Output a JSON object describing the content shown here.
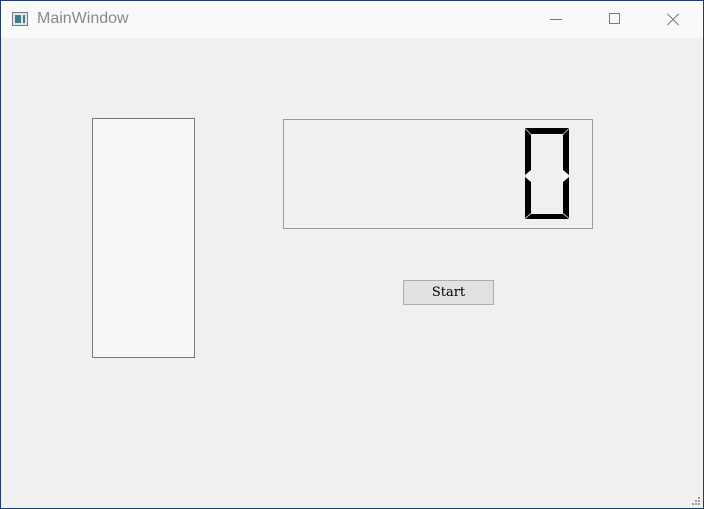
{
  "window": {
    "title": "MainWindow",
    "icon": "app-window-icon",
    "controls": [
      "minimize-icon",
      "maximize-icon",
      "close-icon"
    ]
  },
  "lcd": {
    "value": "0",
    "segment_color": "#000000"
  },
  "start_button": {
    "label": "Start"
  }
}
